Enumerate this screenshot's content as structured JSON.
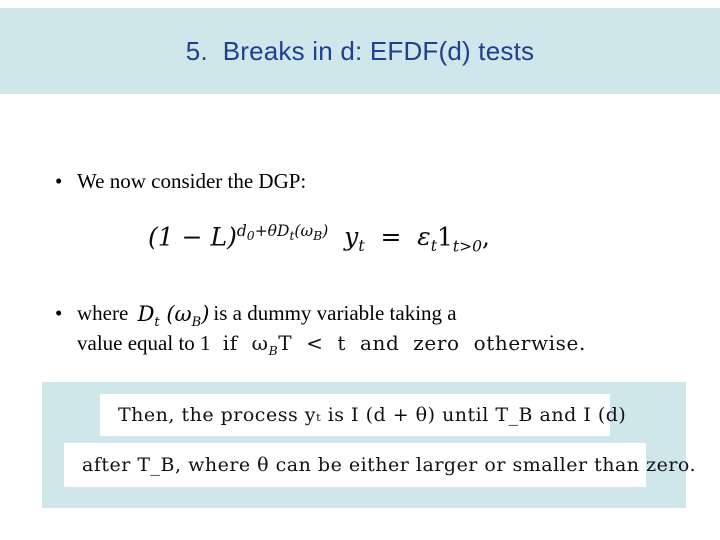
{
  "slide": {
    "title": "5.  Breaks in d: EFDF(d) tests",
    "bullets": [
      {
        "marker": "•",
        "text": "We now consider the DGP:"
      },
      {
        "marker": "•",
        "text_before": "where",
        "inline_formula": "Dₜ (ω_B)",
        "text_after": "is a dummy variable taking a",
        "line2": "value equal to 1",
        "line2_formula": "if ω_B T  <  t  and  zero  otherwise."
      }
    ],
    "equation": {
      "lhs_base": "(1 − L)",
      "lhs_exponent": "d₀+θDₜ(ω_B)",
      "rhs": "yₜ = εₜ 1_{t>0} ,"
    },
    "panel": {
      "line1": "Then,  the  process  yₜ  is  I (d + θ)  until  T_B  and  I (d)",
      "line2": "after  T_B,  where  θ  can  be  either  larger  or  smaller  than  zero."
    },
    "colors": {
      "banner": "#cfe7ea",
      "title_text": "#1f3f8f",
      "body_text": "#000000",
      "panel": "#cfe7ea",
      "strip": "#ffffff"
    }
  }
}
